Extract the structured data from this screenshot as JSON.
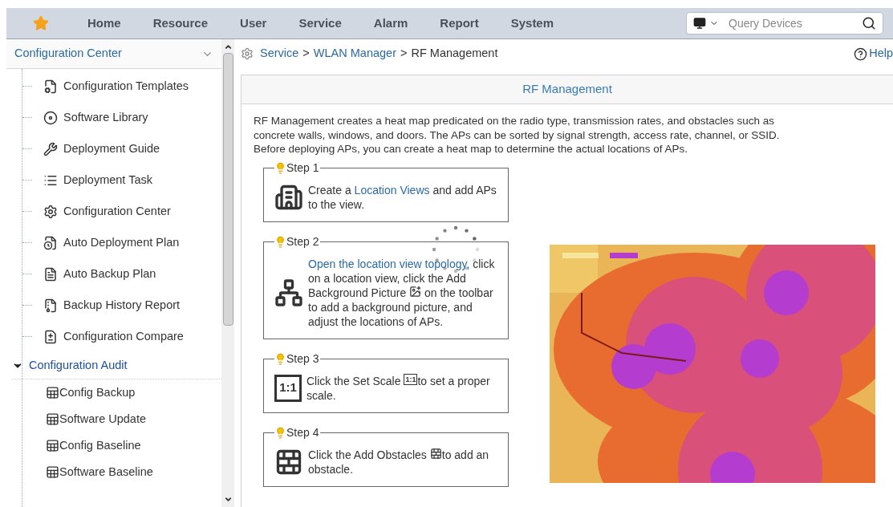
{
  "nav": {
    "items": [
      {
        "label": "Home",
        "selected": false
      },
      {
        "label": "Resource",
        "selected": false
      },
      {
        "label": "User",
        "selected": false
      },
      {
        "label": "Service",
        "selected": false
      },
      {
        "label": "Alarm",
        "selected": false
      },
      {
        "label": "Report",
        "selected": false
      },
      {
        "label": "System",
        "selected": false
      }
    ],
    "search": {
      "placeholder": "Query Devices"
    }
  },
  "sidebar": {
    "title": "Configuration Center",
    "items": [
      {
        "label": "Configuration Templates"
      },
      {
        "label": "Software Library"
      },
      {
        "label": "Deployment Guide"
      },
      {
        "label": "Deployment Task"
      },
      {
        "label": "Configuration Center"
      },
      {
        "label": "Auto Deployment Plan"
      },
      {
        "label": "Auto Backup Plan"
      },
      {
        "label": "Backup History Report"
      },
      {
        "label": "Configuration Compare"
      }
    ],
    "group": {
      "label": "Configuration Audit",
      "expanded": true,
      "children": [
        {
          "label": "Config Backup"
        },
        {
          "label": "Software Update"
        },
        {
          "label": "Config Baseline"
        },
        {
          "label": "Software Baseline"
        }
      ]
    }
  },
  "breadcrumb": [
    {
      "label": "Service",
      "kind": "link"
    },
    {
      "label": ">",
      "kind": "separator"
    },
    {
      "label": "WLAN Manager",
      "kind": "link"
    },
    {
      "label": ">",
      "kind": "separator"
    },
    {
      "label": "RF Management",
      "kind": "current"
    }
  ],
  "help": "Help",
  "panel": {
    "title": "RF Management",
    "intro": "RF Management creates a heat map predicated on the radio type, transmission rates, and obstacles such as concrete walls, windows, and doors. The APs can be sorted by signal strength, access rate, channel, or SSID. Before deploying APs, you can create a heat map to determine the actual locations of APs.",
    "steps": [
      {
        "title": "Step 1",
        "parts": [
          {
            "kind": "text",
            "text": "Create a "
          },
          {
            "kind": "link",
            "text": "Location Views"
          },
          {
            "kind": "text",
            "text": " and add APs to the view."
          }
        ]
      },
      {
        "title": "Step 2",
        "parts": [
          {
            "kind": "link",
            "text": "Open the location view topology,"
          },
          {
            "kind": "text",
            "text": " click on a location view, click the Add Background Picture "
          },
          {
            "kind": "icon"
          },
          {
            "kind": "text",
            "text": " on the toolbar to add a background picture, and adjust the locations of APs."
          }
        ]
      },
      {
        "title": "Step 3",
        "icon_text": "1:1",
        "parts": [
          {
            "kind": "text",
            "text": "Click the Set Scale "
          },
          {
            "kind": "icon",
            "text": "1:1"
          },
          {
            "kind": "text",
            "text": "to set a proper scale."
          }
        ]
      },
      {
        "title": "Step 4",
        "parts": [
          {
            "kind": "text",
            "text": "Click the Add Obstacles "
          },
          {
            "kind": "icon"
          },
          {
            "kind": "text",
            "text": "to add an obstacle."
          }
        ]
      }
    ]
  }
}
